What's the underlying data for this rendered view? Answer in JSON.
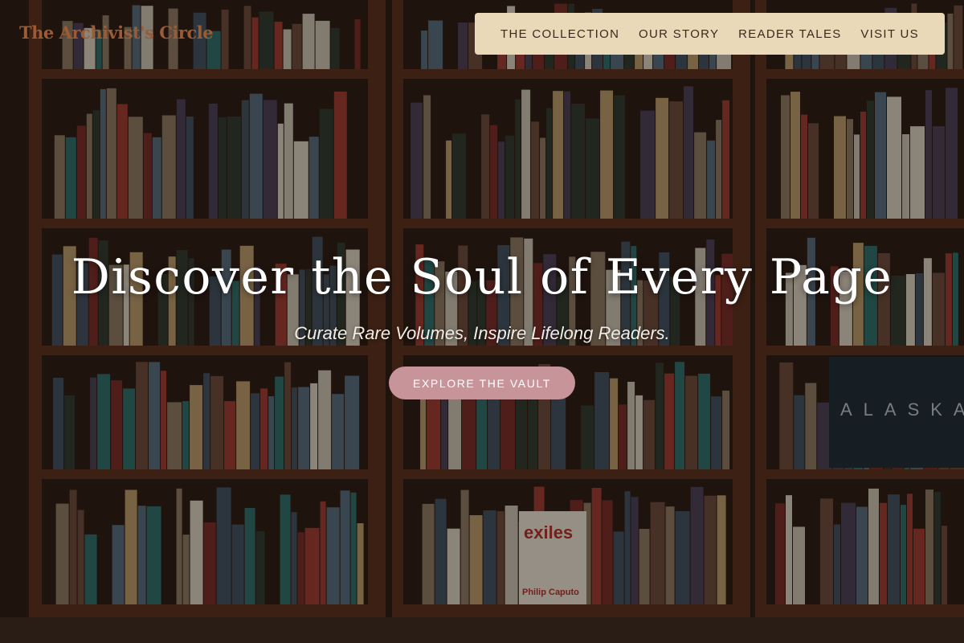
{
  "header": {
    "logo_text": "The Archivist's Circle",
    "nav": [
      {
        "label": "THE COLLECTION"
      },
      {
        "label": "OUR STORY"
      },
      {
        "label": "READER TALES"
      },
      {
        "label": "VISIT US"
      }
    ]
  },
  "hero": {
    "title": "Discover the Soul of Every Page",
    "subtitle": "Curate Rare Volumes, Inspire Lifelong Readers.",
    "cta_label": "EXPLORE THE VAULT"
  },
  "background": {
    "image": "bookshelf-photo",
    "visible_text": [
      "exiles",
      "Philip Caputo",
      "ALASKA"
    ]
  },
  "colors": {
    "nav_bg": "#ead9b8",
    "nav_text": "#3a2a1f",
    "logo": "#9a5b35",
    "cta_bg": "#c7949a",
    "hero_text": "#ffffff"
  }
}
